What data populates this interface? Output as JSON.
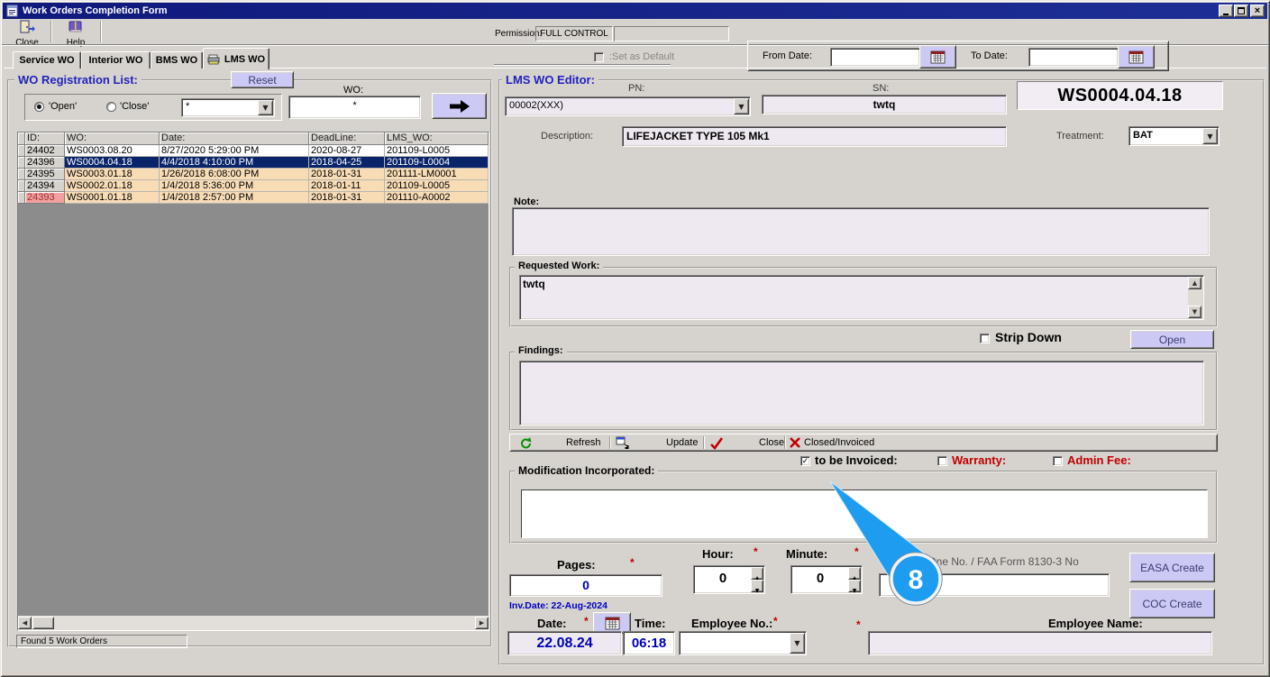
{
  "window": {
    "title": "Work Orders Completion Form"
  },
  "toolbar": {
    "close_label": "Close",
    "help_label": "Help"
  },
  "permission": {
    "label": "Permission:",
    "value": "FULL CONTROL"
  },
  "tabs": {
    "service": "Service WO",
    "interior": "Interior WO",
    "bms": "BMS WO",
    "lms": "LMS WO"
  },
  "filters": {
    "set_as_default": ":Set as Default",
    "from_date_label": "From Date:",
    "from_date_value": "",
    "to_date_label": "To Date:",
    "to_date_value": ""
  },
  "registration": {
    "title": "WO Registration List:",
    "reset_button": "Reset",
    "open_radio": "'Open'",
    "close_radio": "'Close'",
    "filter_value": "*",
    "wo_label": "WO:",
    "wo_value": "*",
    "headers": {
      "id": "ID:",
      "wo": "WO:",
      "date": "Date:",
      "deadline": "DeadLine:",
      "lms": "LMS_WO:"
    },
    "rows": [
      {
        "id": "24402",
        "wo": "WS0003.08.20",
        "date": "8/27/2020 5:29:00 PM",
        "deadline": "2020-08-27",
        "lms": "201109-L0005"
      },
      {
        "id": "24396",
        "wo": "WS0004.04.18",
        "date": "4/4/2018 4:10:00 PM",
        "deadline": "2018-04-25",
        "lms": "201109-L0004"
      },
      {
        "id": "24395",
        "wo": "WS0003.01.18",
        "date": "1/26/2018 6:08:00 PM",
        "deadline": "2018-01-31",
        "lms": "201111-LM0001"
      },
      {
        "id": "24394",
        "wo": "WS0002.01.18",
        "date": "1/4/2018 5:36:00 PM",
        "deadline": "2018-01-11",
        "lms": "201109-L0005"
      },
      {
        "id": "24393",
        "wo": "WS0001.01.18",
        "date": "1/4/2018 2:57:00 PM",
        "deadline": "2018-01-31",
        "lms": "201110-A0002"
      }
    ],
    "status": "Found 5 Work Orders"
  },
  "editor": {
    "title": "LMS WO Editor:",
    "pn_label": "PN:",
    "pn_value": "00002(XXX)",
    "sn_label": "SN:",
    "sn_value": "twtq",
    "wo_number": "WS0004.04.18",
    "description_label": "Description:",
    "description_value": "LIFEJACKET TYPE 105 Mk1",
    "treatment_label": "Treatment:",
    "treatment_value": "BAT",
    "note_label": "Note:",
    "note_value": "",
    "requested_work_label": "Requested Work:",
    "requested_work_value": "twtq",
    "strip_down_label": "Strip Down",
    "open_button": "Open",
    "findings_label": "Findings:",
    "findings_value": "",
    "actions": {
      "refresh": "Refresh",
      "update": "Update",
      "close": "Close",
      "closed_invoiced": "Closed/Invoiced"
    },
    "to_be_invoiced_label": "to be Invoiced:",
    "warranty_label": "Warranty:",
    "admin_fee_label": "Admin Fee:",
    "modification_label": "Modification Incorporated:",
    "modification_value": "",
    "pages_label": "Pages:",
    "pages_value": "0",
    "hour_label": "Hour:",
    "hour_value": "0",
    "minute_label": "Minute:",
    "minute_value": "0",
    "form_one_label": "Form One No. / FAA Form 8130-3 No",
    "form_one_value": "",
    "easa_button": "EASA Create",
    "coc_button": "COC Create",
    "inv_date": "Inv.Date: 22-Aug-2024",
    "date_label": "Date:",
    "date_value": "22.08.24",
    "time_label": "Time:",
    "time_value": "06:18",
    "employee_no_label": "Employee No.:",
    "employee_no_value": "",
    "employee_name_label": "Employee Name:",
    "employee_name_value": "",
    "required_marker": "*"
  },
  "callout": {
    "number": "8",
    "color": "#1e9cf0"
  },
  "colors": {
    "accent_lavender": "#ccc9f5",
    "selected_row": "#0a246a",
    "row_peach": "#f8dcb6",
    "alert_cell": "#f2a0a2",
    "required_red": "#c00000",
    "value_blue": "#0000b8",
    "legend_blue": "#2222bd",
    "titlebar_navy": "#10197c"
  }
}
